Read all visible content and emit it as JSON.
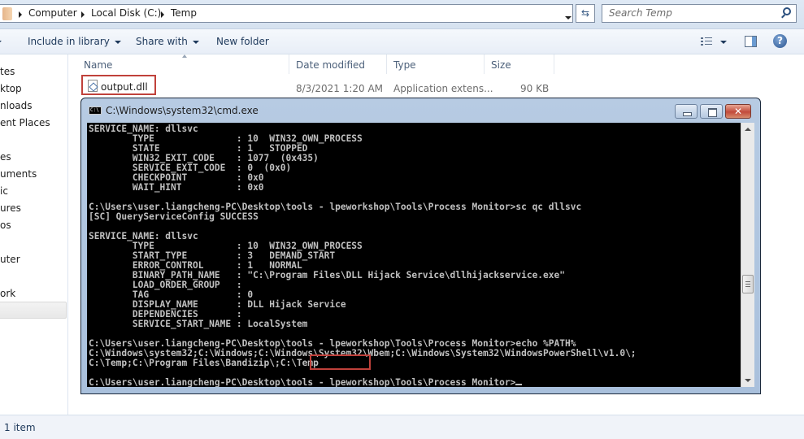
{
  "window": {
    "breadcrumbs": [
      "Computer",
      "Local Disk (C:)",
      "Temp"
    ],
    "search_placeholder": "Search Temp"
  },
  "toolbar": {
    "include_in_library": "Include in library",
    "share_with": "Share with",
    "new_folder": "New folder"
  },
  "nav_pane": {
    "items": [
      "tes",
      "ktop",
      "nloads",
      "ent Places",
      "es",
      "uments",
      "ic",
      "ures",
      "os",
      "uter",
      "ork"
    ],
    "selected": "uter"
  },
  "file_list": {
    "columns": [
      "Name",
      "Date modified",
      "Type",
      "Size"
    ],
    "rows": [
      {
        "name": "output.dll",
        "date_modified": "8/3/2021 1:20 AM",
        "type": "Application extens...",
        "size": "90 KB"
      }
    ]
  },
  "status_bar": {
    "text": "1 item"
  },
  "cmd_window": {
    "title": "C:\\Windows\\system32\\cmd.exe",
    "icon_label": "C:\\",
    "close_glyph": "✕",
    "lines": [
      "SERVICE_NAME: dllsvc",
      "        TYPE               : 10  WIN32_OWN_PROCESS",
      "        STATE              : 1   STOPPED",
      "        WIN32_EXIT_CODE    : 1077  (0x435)",
      "        SERVICE_EXIT_CODE  : 0  (0x0)",
      "        CHECKPOINT         : 0x0",
      "        WAIT_HINT          : 0x0",
      "",
      "C:\\Users\\user.liangcheng-PC\\Desktop\\tools - lpeworkshop\\Tools\\Process Monitor>sc qc dllsvc",
      "[SC] QueryServiceConfig SUCCESS",
      "",
      "SERVICE_NAME: dllsvc",
      "        TYPE               : 10  WIN32_OWN_PROCESS",
      "        START_TYPE         : 3   DEMAND_START",
      "        ERROR_CONTROL      : 1   NORMAL",
      "        BINARY_PATH_NAME   : \"C:\\Program Files\\DLL Hijack Service\\dllhijackservice.exe\"",
      "        LOAD_ORDER_GROUP   :",
      "        TAG                : 0",
      "        DISPLAY_NAME       : DLL Hijack Service",
      "        DEPENDENCIES       :",
      "        SERVICE_START_NAME : LocalSystem",
      "",
      "C:\\Users\\user.liangcheng-PC\\Desktop\\tools - lpeworkshop\\Tools\\Process Monitor>echo %PATH%",
      "C:\\Windows\\system32;C:\\Windows;C:\\Windows\\System32\\Wbem;C:\\Windows\\System32\\WindowsPowerShell\\v1.0\\;",
      "C:\\Temp;C:\\Program Files\\Bandizip\\;C:\\Temp",
      "",
      "C:\\Users\\user.liangcheng-PC\\Desktop\\tools - lpeworkshop\\Tools\\Process Monitor>"
    ]
  },
  "colors": {
    "highlight_box": "#c0413b",
    "console_bg": "#000000",
    "console_fg": "#c0c0c0"
  }
}
